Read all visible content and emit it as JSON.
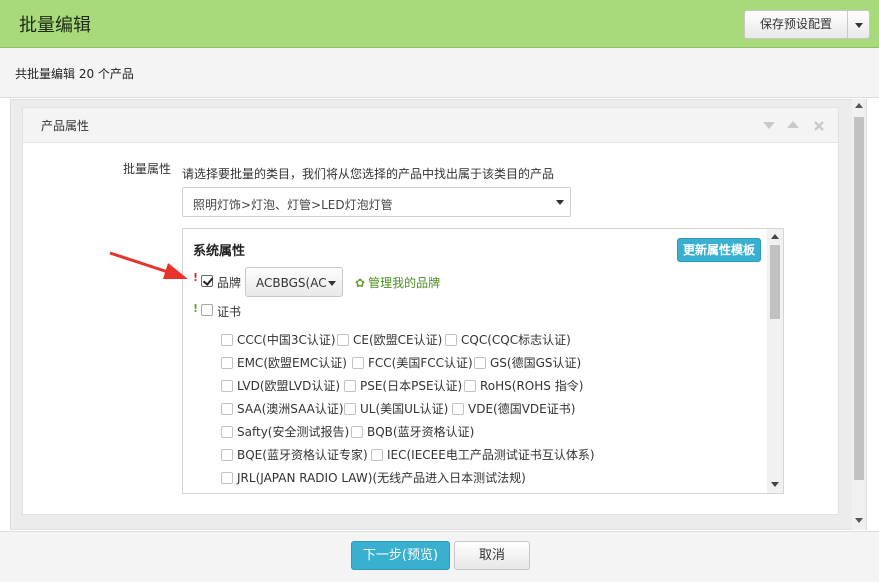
{
  "window": {
    "title": "批量编辑",
    "refresh_icon": "refresh-icon",
    "close_icon": "close-icon"
  },
  "subbar": {
    "count_text": "共批量编辑 20 个产品",
    "preset_button": "保存预设配置"
  },
  "panel": {
    "title": "产品属性",
    "controls": [
      "chevron-down-icon",
      "chevron-up-icon",
      "close-icon"
    ]
  },
  "batch": {
    "label": "批量属性",
    "hint": "请选择要批量的类目，我们将从您选择的产品中找出属于该类目的产品",
    "category_value": "照明灯饰>灯泡、灯管>LED灯泡灯管"
  },
  "system_attrs": {
    "title": "系统属性",
    "update_button": "更新属性模板",
    "brand": {
      "required_mark": "!",
      "label": "品牌",
      "checked": true,
      "value": "ACBBGS(AC",
      "manage_link": "管理我的品牌"
    },
    "certificate": {
      "required_mark": "!",
      "label": "证书",
      "checked": false
    },
    "cert_options": [
      "CCC(中国3C认证)",
      "CE(欧盟CE认证)",
      "CQC(CQC标志认证)",
      "EMC(欧盟EMC认证)",
      "FCC(美国FCC认证)",
      "GS(德国GS认证)",
      "LVD(欧盟LVD认证)",
      "PSE(日本PSE认证)",
      "RoHS(ROHS 指令)",
      "SAA(澳洲SAA认证)",
      "UL(美国UL认证)",
      "VDE(德国VDE证书)",
      "Safty(安全测试报告)",
      "BQB(蓝牙资格认证)",
      "BQE(蓝牙资格认证专家)",
      "IEC(IECEE电工产品测试证书互认体系)",
      "JRL(JAPAN RADIO LAW)(无线产品进入日本测试法规)"
    ]
  },
  "footer": {
    "next_button": "下一步(预览)",
    "cancel_button": "取消"
  },
  "colors": {
    "titlebar": "#a8d97a",
    "accent_button": "#3ab0d0",
    "required_red": "#d9302c",
    "required_green": "#5fa82d",
    "link_green": "#4a8f1f",
    "arrow_red": "#e8322b"
  }
}
